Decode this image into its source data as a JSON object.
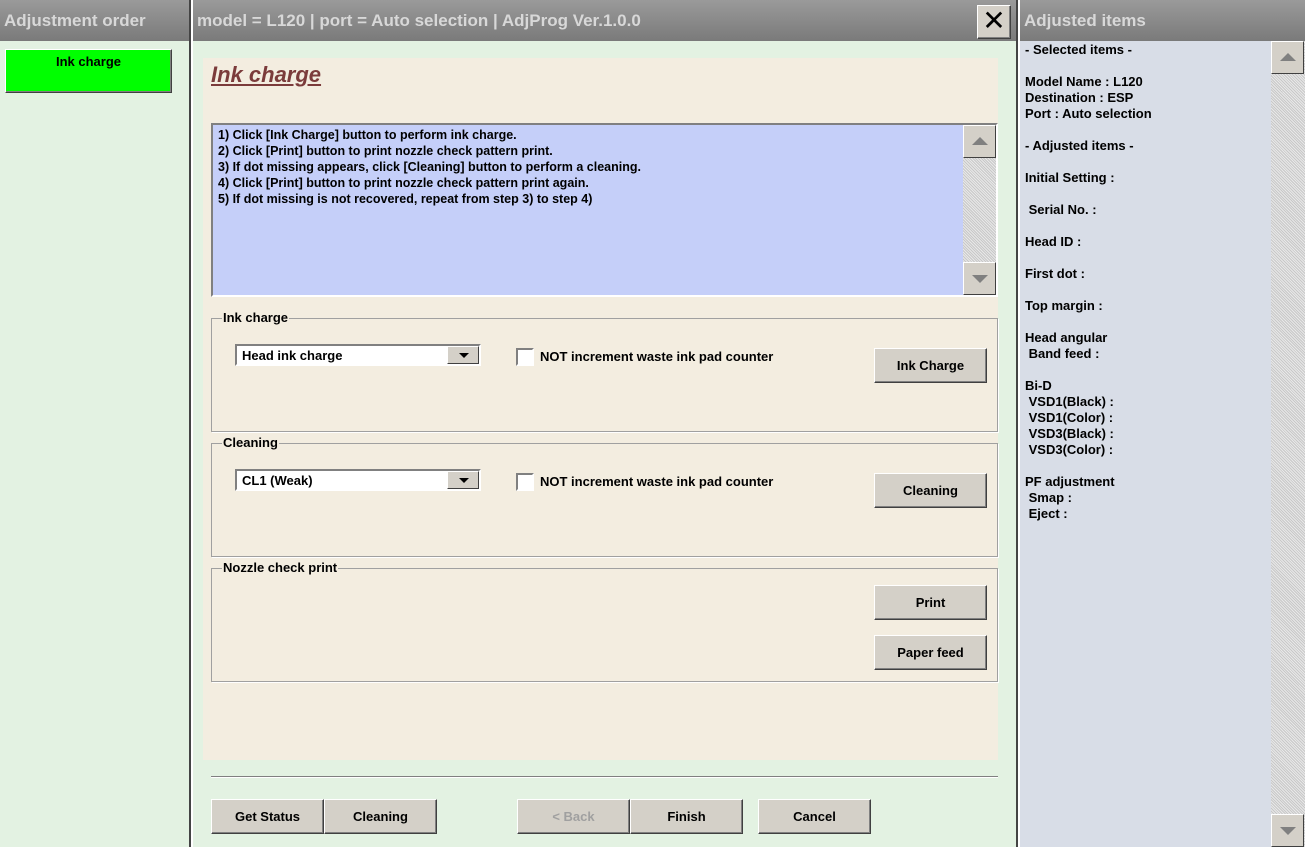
{
  "left": {
    "header": "Adjustment order",
    "items": [
      {
        "label": "Ink charge",
        "color": "#00ff00"
      }
    ]
  },
  "main": {
    "header": "model = L120  |  port = Auto selection  |  AdjProg Ver.1.0.0",
    "close_icon": "close-x-icon",
    "title": "Ink charge",
    "instructions": [
      "1) Click [Ink Charge] button to perform ink charge.",
      "2) Click [Print] button to print nozzle check pattern print.",
      "3) If dot missing appears, click [Cleaning] button to perform a cleaning.",
      "4) Click [Print] button to print nozzle check pattern print again.",
      "5) If dot missing is not recovered, repeat from step 3) to step 4)"
    ],
    "ink_charge": {
      "label": "Ink charge",
      "select": "Head ink charge",
      "checkbox": "NOT increment waste ink pad counter",
      "checked": false,
      "button": "Ink Charge"
    },
    "cleaning": {
      "label": "Cleaning",
      "select": "CL1 (Weak)",
      "checkbox": "NOT increment waste ink pad counter",
      "checked": false,
      "button": "Cleaning"
    },
    "nozzle": {
      "label": "Nozzle check print",
      "print": "Print",
      "paper_feed": "Paper feed"
    },
    "footer": {
      "get_status": "Get Status",
      "cleaning": "Cleaning",
      "back": "< Back",
      "finish": "Finish",
      "cancel": "Cancel"
    }
  },
  "right": {
    "header": "Adjusted items",
    "text": "- Selected items -\n\nModel Name : L120\nDestination : ESP\nPort : Auto selection\n\n- Adjusted items -\n\nInitial Setting :\n\n Serial No. :\n\nHead ID :\n\nFirst dot :\n\nTop margin :\n\nHead angular\n Band feed :\n\nBi-D\n VSD1(Black) :\n VSD1(Color) :\n VSD3(Black) :\n VSD3(Color) :\n\nPF adjustment\n Smap :\n Eject :"
  }
}
